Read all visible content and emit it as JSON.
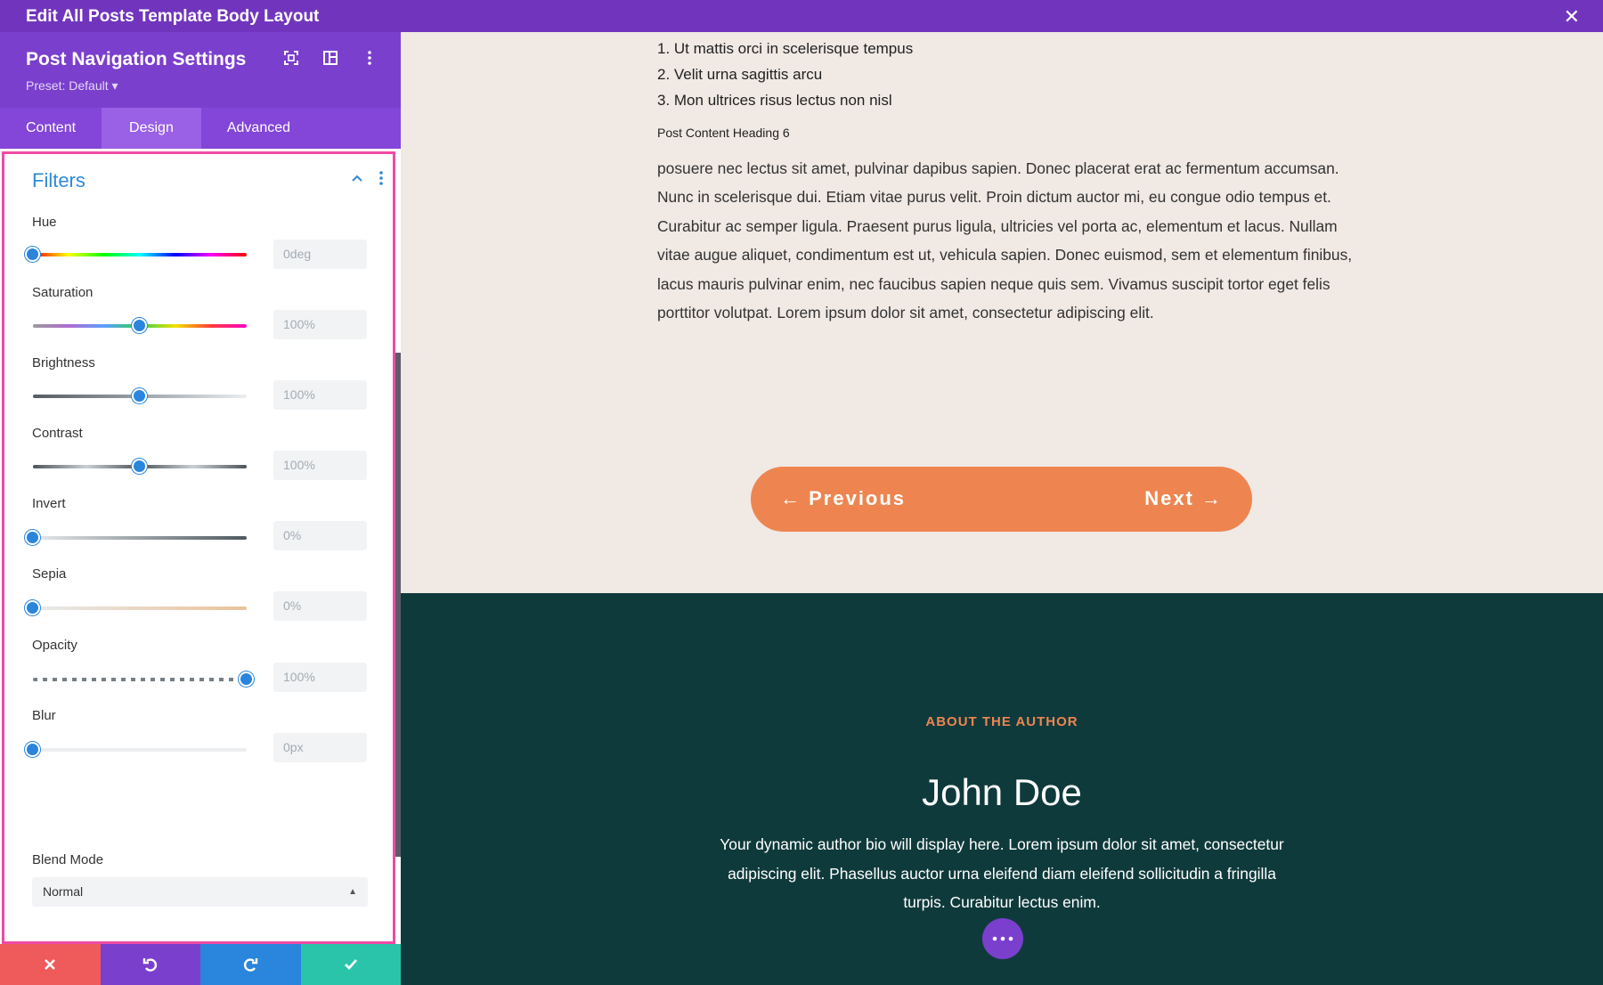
{
  "topbar": {
    "title": "Edit All Posts Template Body Layout",
    "close_icon": "close-icon"
  },
  "panel": {
    "title": "Post Navigation Settings",
    "preset": "Preset: Default ▾",
    "tabs": [
      "Content",
      "Design",
      "Advanced"
    ],
    "active_tab": "Design",
    "group_title": "Filters",
    "fields": [
      {
        "label": "Hue",
        "value": "0deg",
        "level": 0
      },
      {
        "label": "Saturation",
        "value": "100%",
        "level": 0.5
      },
      {
        "label": "Brightness",
        "value": "100%",
        "level": 0.5
      },
      {
        "label": "Contrast",
        "value": "100%",
        "level": 0.5
      },
      {
        "label": "Invert",
        "value": "0%",
        "level": 0
      },
      {
        "label": "Sepia",
        "value": "0%",
        "level": 0
      },
      {
        "label": "Opacity",
        "value": "100%",
        "level": 1
      },
      {
        "label": "Blur",
        "value": "0px",
        "level": 0
      }
    ],
    "blend_label": "Blend Mode",
    "blend_value": "Normal",
    "actions": [
      {
        "name": "discard",
        "icon": "close-icon",
        "color": "#ef5a5a"
      },
      {
        "name": "undo",
        "icon": "undo-icon",
        "color": "#7b3fcd"
      },
      {
        "name": "redo",
        "icon": "redo-icon",
        "color": "#2a85dc"
      },
      {
        "name": "save",
        "icon": "check-icon",
        "color": "#29c4a9"
      }
    ]
  },
  "content": {
    "list": [
      "1. Ut mattis orci in scelerisque tempus",
      "2. Velit urna sagittis arcu",
      "3. Mon ultrices risus lectus non nisl"
    ],
    "heading6": "Post Content Heading 6",
    "paragraph": "posuere nec lectus sit amet, pulvinar dapibus sapien. Donec placerat erat ac fermentum accumsan. Nunc in scelerisque dui. Etiam vitae purus velit. Proin dictum auctor mi, eu congue odio tempus et. Curabitur ac semper ligula. Praesent purus ligula, ultricies vel porta ac, elementum et lacus. Nullam vitae augue aliquet, condimentum est ut, vehicula sapien. Donec euismod, sem et elementum finibus, lacus mauris pulvinar enim, nec faucibus sapien neque quis sem. Vivamus suscipit tortor eget felis porttitor volutpat. Lorem ipsum dolor sit amet, consectetur adipiscing elit.",
    "prev_label": "← Previous",
    "next_label": "Next →"
  },
  "author": {
    "section_label": "ABOUT THE AUTHOR",
    "name": "John Doe",
    "bio": "Your dynamic author bio will display here. Lorem ipsum dolor sit amet, consectetur adipiscing elit. Phasellus auctor urna eleifend diam eleifend sollicitudin a fringilla turpis. Curabitur lectus enim."
  },
  "colors": {
    "accent": "#7b3fcd",
    "highlight": "#ef4aa5",
    "orange": "#ee8550",
    "dark_teal": "#0f3a3b"
  }
}
